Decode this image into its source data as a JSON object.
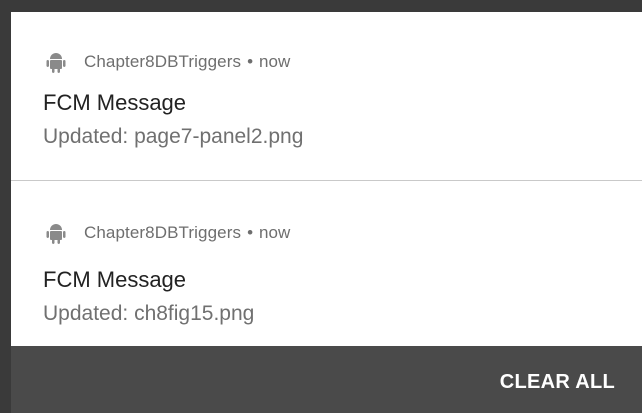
{
  "notifications": [
    {
      "app_name": "Chapter8DBTriggers",
      "separator": "•",
      "time": "now",
      "title": "FCM Message",
      "body": "Updated: page7-panel2.png",
      "icon": "android-icon"
    },
    {
      "app_name": "Chapter8DBTriggers",
      "separator": "•",
      "time": "now",
      "title": "FCM Message",
      "body": "Updated: ch8fig15.png",
      "icon": "android-icon"
    }
  ],
  "actions": {
    "clear_all_label": "CLEAR ALL"
  },
  "colors": {
    "card_background": "#ffffff",
    "shade_background": "#4a4a4a",
    "secondary_text": "#6e6e6e",
    "primary_text": "#222222"
  }
}
